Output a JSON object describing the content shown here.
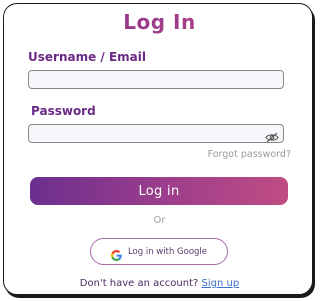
{
  "header": {
    "title": "Log In"
  },
  "form": {
    "username": {
      "label": "Username / Email",
      "value": "",
      "placeholder": ""
    },
    "password": {
      "label": "Password",
      "value": "",
      "placeholder": "",
      "toggle_icon": "eye-off-icon"
    },
    "forgot_password": "Forgot password?",
    "submit_label": "Log in",
    "separator": "Or",
    "google_button": {
      "label": "Log in with Google",
      "icon": "google-icon"
    },
    "signup": {
      "prompt": "Don't have an account?",
      "link": "Sign up"
    }
  },
  "colors": {
    "accent_start": "#6b2f8e",
    "accent_end": "#c04c82",
    "label": "#6a2a86",
    "link": "#3e6fc9"
  }
}
